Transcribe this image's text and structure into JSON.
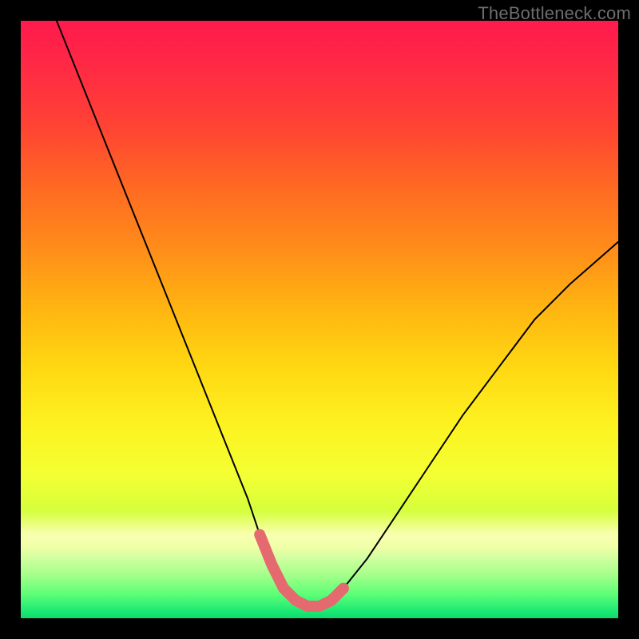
{
  "watermark": {
    "text": "TheBottleneck.com"
  },
  "chart_data": {
    "type": "line",
    "title": "",
    "xlabel": "",
    "ylabel": "",
    "xlim": [
      0,
      100
    ],
    "ylim": [
      0,
      100
    ],
    "grid": false,
    "legend": false,
    "series": [
      {
        "name": "bottleneck-curve",
        "x": [
          6,
          10,
          14,
          18,
          22,
          26,
          30,
          34,
          38,
          40,
          42,
          44,
          46,
          48,
          50,
          52,
          54,
          58,
          62,
          68,
          74,
          80,
          86,
          92,
          100
        ],
        "values": [
          100,
          90,
          80,
          70,
          60,
          50,
          40,
          30,
          20,
          14,
          9,
          5,
          3,
          2,
          2,
          3,
          5,
          10,
          16,
          25,
          34,
          42,
          50,
          56,
          63
        ],
        "stroke": "#000000",
        "stroke_width": 2
      },
      {
        "name": "optimal-zone-highlight",
        "x": [
          40,
          42,
          44,
          46,
          48,
          50,
          52,
          54
        ],
        "values": [
          14,
          9,
          5,
          3,
          2,
          2,
          3,
          5
        ],
        "stroke": "#e46a6f",
        "stroke_width": 14
      }
    ],
    "background_gradient": {
      "direction": "vertical",
      "stops": [
        {
          "pos": 0.0,
          "color": "#ff1a4d"
        },
        {
          "pos": 0.38,
          "color": "#ff8c1a"
        },
        {
          "pos": 0.68,
          "color": "#fdf321"
        },
        {
          "pos": 0.9,
          "color": "#cfffa0"
        },
        {
          "pos": 1.0,
          "color": "#10d86a"
        }
      ]
    }
  }
}
